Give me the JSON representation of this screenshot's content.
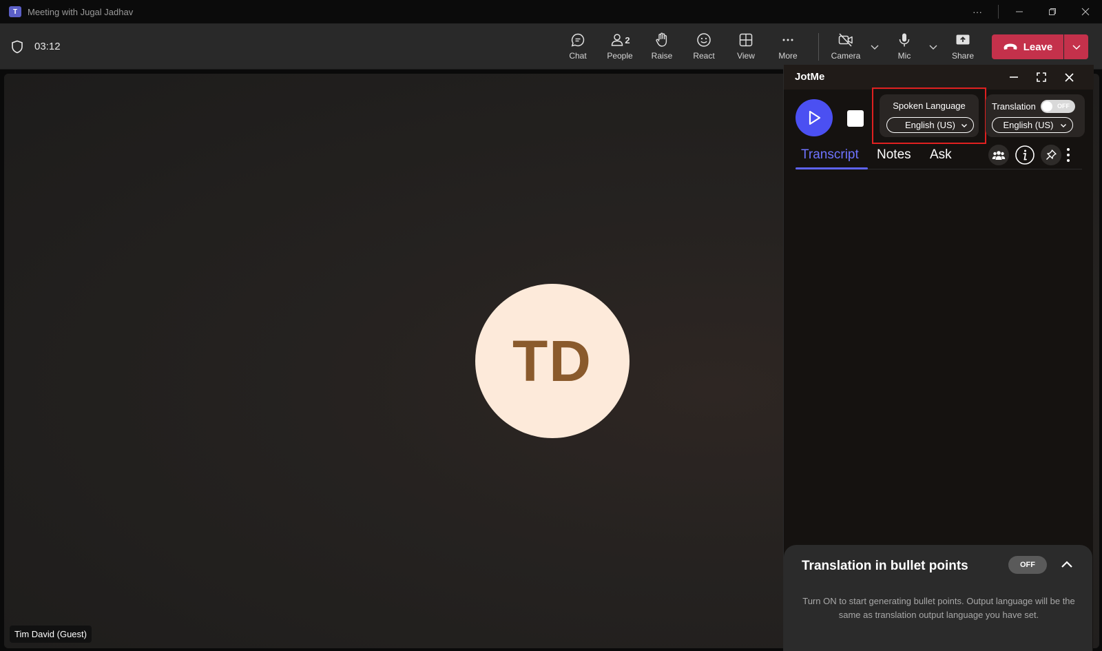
{
  "window": {
    "title": "Meeting with Jugal Jadhav",
    "app_icon": "teams-icon"
  },
  "meeting": {
    "timer": "03:12"
  },
  "toolbar": {
    "chat_label": "Chat",
    "people_label": "People",
    "people_count": "2",
    "raise_label": "Raise",
    "react_label": "React",
    "view_label": "View",
    "more_label": "More",
    "camera_label": "Camera",
    "mic_label": "Mic",
    "share_label": "Share",
    "leave_label": "Leave",
    "leave_color": "#c4314b"
  },
  "stage": {
    "avatar_initials": "TD",
    "participant_name": "Tim David (Guest)",
    "avatar_bg": "#fdeada",
    "avatar_fg": "#8a5a2c"
  },
  "jotme": {
    "title": "JotMe",
    "spoken_language_label": "Spoken Language",
    "spoken_language_value": "English (US)",
    "translation_label": "Translation",
    "translation_toggle": "OFF",
    "translation_language_value": "English (US)",
    "tabs": [
      "Transcript",
      "Notes",
      "Ask"
    ],
    "active_tab": "Transcript",
    "accent": "#4b50f2",
    "bullet_points": {
      "title": "Translation in bullet points",
      "toggle": "OFF",
      "description": "Turn ON to start generating bullet points. Output language will be the same as translation output language you have set."
    }
  }
}
